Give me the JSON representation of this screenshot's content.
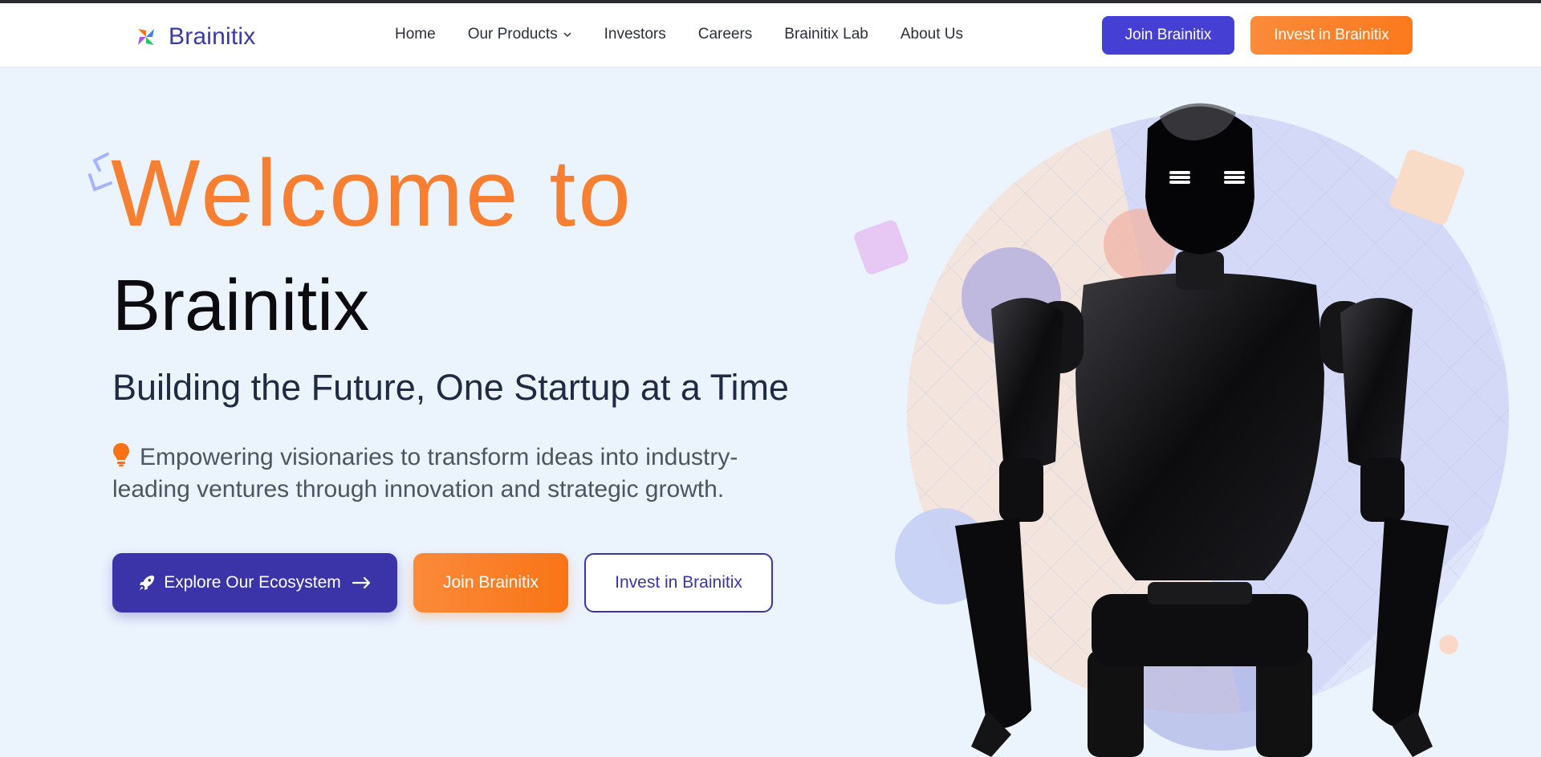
{
  "header": {
    "logo_text": "Brainitix",
    "logo_icon": "pinwheel-logo-icon",
    "nav": [
      {
        "label": "Home"
      },
      {
        "label": "Our Products",
        "has_dropdown": true
      },
      {
        "label": "Investors"
      },
      {
        "label": "Careers"
      },
      {
        "label": "Brainitix Lab"
      },
      {
        "label": "About Us"
      }
    ],
    "join_button": "Join Brainitix",
    "invest_button": "Invest in Brainitix"
  },
  "hero": {
    "welcome": "Welcome to",
    "brand": "Brainitix",
    "subtitle": "Building the Future, One Startup at a Time",
    "description": "Empowering visionaries to transform ideas into industry-leading ventures through innovation and strategic growth.",
    "description_icon": "lightbulb-icon",
    "buttons": {
      "explore": "Explore Our Ecosystem",
      "join": "Join Brainitix",
      "invest": "Invest in Brainitix"
    },
    "image_subject": "black humanoid robot"
  },
  "colors": {
    "primary": "#3b34a8",
    "accent_orange": "#f67f32",
    "background": "#ebf3fd",
    "header_bg": "#ffffff"
  }
}
